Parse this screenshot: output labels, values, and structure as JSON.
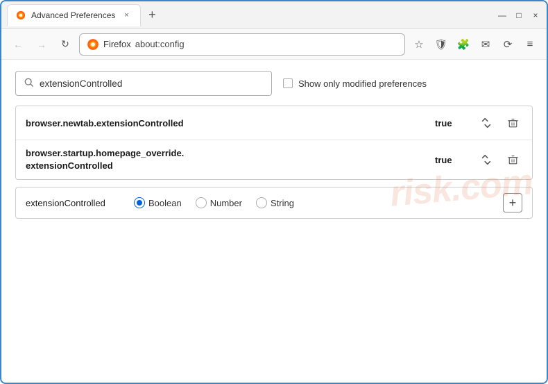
{
  "window": {
    "title": "Advanced Preferences",
    "tab_close": "×",
    "tab_new": "+",
    "win_min": "—",
    "win_max": "□",
    "win_close": "×"
  },
  "nav": {
    "back": "←",
    "forward": "→",
    "refresh": "↻",
    "firefox_label": "Firefox",
    "address": "about:config",
    "bookmark_icon": "☆",
    "shield_icon": "🛡",
    "ext_icon": "🧩",
    "email_icon": "✉",
    "sync_icon": "⟳",
    "menu_icon": "≡"
  },
  "search": {
    "placeholder": "extensionControlled",
    "show_modified_label": "Show only modified preferences"
  },
  "prefs": [
    {
      "name": "browser.newtab.extensionControlled",
      "value": "true"
    },
    {
      "name_line1": "browser.startup.homepage_override.",
      "name_line2": "extensionControlled",
      "value": "true"
    }
  ],
  "new_pref": {
    "name": "extensionControlled",
    "types": [
      {
        "label": "Boolean",
        "selected": true
      },
      {
        "label": "Number",
        "selected": false
      },
      {
        "label": "String",
        "selected": false
      }
    ],
    "add_label": "+"
  },
  "watermark": "risk.com"
}
